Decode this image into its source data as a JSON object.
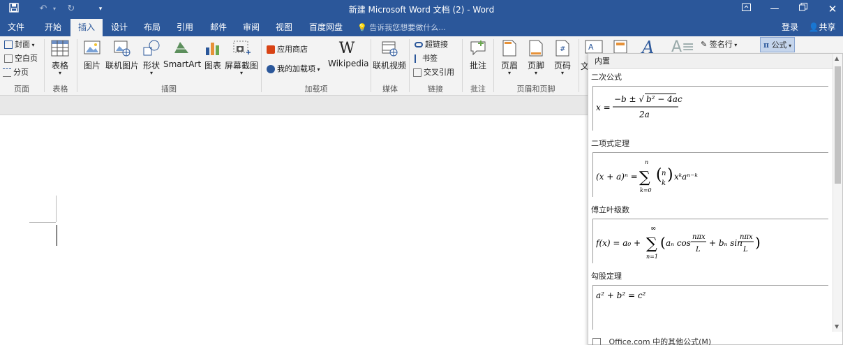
{
  "window": {
    "title": "新建 Microsoft Word 文档 (2) - Word",
    "quick_access": {
      "save": "save-icon",
      "undo": "undo-icon",
      "redo": "redo-icon",
      "customize": "customize-icon"
    }
  },
  "tabs": [
    {
      "label": "文件"
    },
    {
      "label": "开始"
    },
    {
      "label": "插入",
      "active": true
    },
    {
      "label": "设计"
    },
    {
      "label": "布局"
    },
    {
      "label": "引用"
    },
    {
      "label": "邮件"
    },
    {
      "label": "审阅"
    },
    {
      "label": "视图"
    },
    {
      "label": "百度网盘"
    }
  ],
  "tell_me": "告诉我您想要做什么...",
  "account": {
    "signin": "登录",
    "share": "共享"
  },
  "ribbon": {
    "pages": {
      "cover": "封面",
      "blank": "空白页",
      "break": "分页",
      "group": "页面"
    },
    "tables": {
      "table": "表格",
      "group": "表格"
    },
    "illustrations": {
      "picture": "图片",
      "online_picture": "联机图片",
      "shapes": "形状",
      "smartart": "SmartArt",
      "chart": "图表",
      "screenshot": "屏幕截图",
      "group": "插图"
    },
    "addins": {
      "store": "应用商店",
      "my_addins": "我的加载项",
      "wikipedia": "Wikipedia",
      "group": "加载项"
    },
    "media": {
      "online_video": "联机视频",
      "group": "媒体"
    },
    "links": {
      "hyperlink": "超链接",
      "bookmark": "书签",
      "cross_ref": "交叉引用",
      "group": "链接"
    },
    "comments": {
      "comment": "批注",
      "group": "批注"
    },
    "header_footer": {
      "header": "页眉",
      "footer": "页脚",
      "page_number": "页码",
      "group": "页眉和页脚"
    },
    "text": {
      "cut_label": "文",
      "signature": "签名行"
    },
    "symbols": {
      "equation": "公式"
    }
  },
  "gallery": {
    "section": "内置",
    "items": [
      {
        "name": "二次公式"
      },
      {
        "name": "二项式定理"
      },
      {
        "name": "傅立叶级数"
      },
      {
        "name": "勾股定理"
      }
    ],
    "footer": "Office.com 中的其他公式(M)"
  },
  "colors": {
    "accent": "#2b579a",
    "ribbon": "#f3f3f3"
  }
}
